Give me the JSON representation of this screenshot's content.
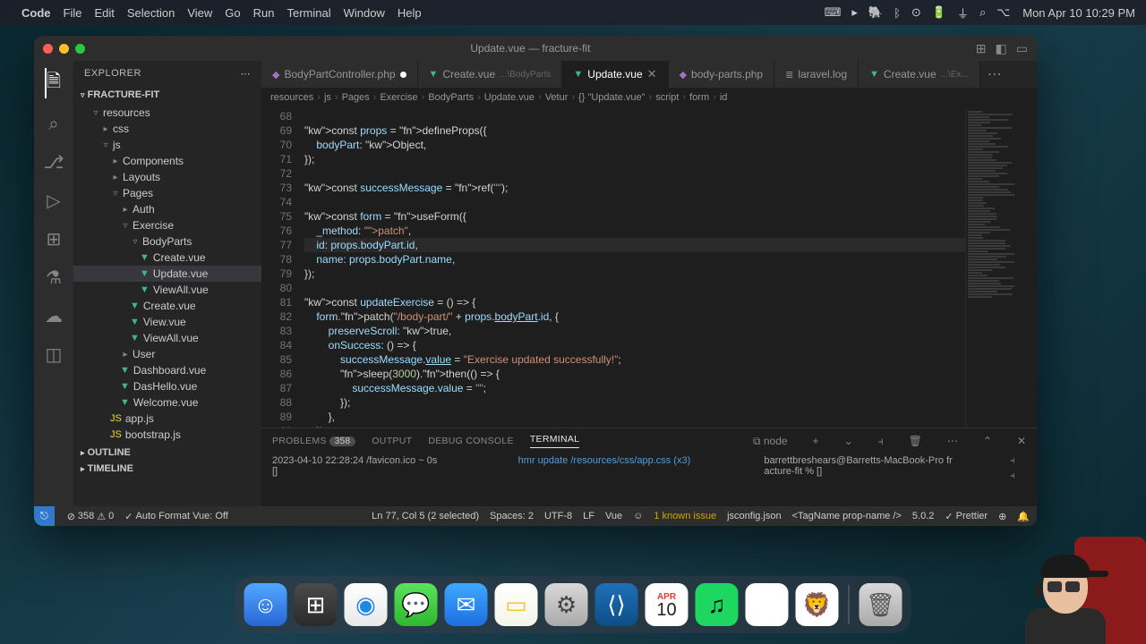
{
  "menubar": {
    "app": "Code",
    "items": [
      "File",
      "Edit",
      "Selection",
      "View",
      "Go",
      "Run",
      "Terminal",
      "Window",
      "Help"
    ],
    "clock": "Mon Apr 10  10:29 PM"
  },
  "titlebar": {
    "title": "Update.vue — fracture-fit"
  },
  "activity": {
    "icons": [
      "files",
      "search",
      "scm",
      "debug",
      "extensions",
      "remote",
      "test",
      "settings",
      "user"
    ]
  },
  "sidebar": {
    "title": "EXPLORER",
    "project": "FRACTURE-FIT",
    "tree": [
      {
        "l": "resources",
        "d": 1,
        "o": true
      },
      {
        "l": "css",
        "d": 2
      },
      {
        "l": "js",
        "d": 2,
        "o": true
      },
      {
        "l": "Components",
        "d": 3
      },
      {
        "l": "Layouts",
        "d": 3
      },
      {
        "l": "Pages",
        "d": 3,
        "o": true
      },
      {
        "l": "Auth",
        "d": 4
      },
      {
        "l": "Exercise",
        "d": 4,
        "o": true
      },
      {
        "l": "BodyParts",
        "d": 5,
        "o": true
      },
      {
        "l": "Create.vue",
        "d": 6,
        "t": "vue"
      },
      {
        "l": "Update.vue",
        "d": 6,
        "t": "vue",
        "sel": true
      },
      {
        "l": "ViewAll.vue",
        "d": 6,
        "t": "vue"
      },
      {
        "l": "Create.vue",
        "d": 5,
        "t": "vue"
      },
      {
        "l": "View.vue",
        "d": 5,
        "t": "vue"
      },
      {
        "l": "ViewAll.vue",
        "d": 5,
        "t": "vue"
      },
      {
        "l": "User",
        "d": 4
      },
      {
        "l": "Dashboard.vue",
        "d": 4,
        "t": "vue"
      },
      {
        "l": "DasHello.vue",
        "d": 4,
        "t": "vue"
      },
      {
        "l": "Welcome.vue",
        "d": 4,
        "t": "vue"
      },
      {
        "l": "app.js",
        "d": 3,
        "t": "js"
      },
      {
        "l": "bootstrap.js",
        "d": 3,
        "t": "js"
      }
    ],
    "outline": "OUTLINE",
    "timeline": "TIMELINE"
  },
  "tabs": [
    {
      "l": "BodyPartController.php",
      "icon": "php",
      "mod": true
    },
    {
      "l": "Create.vue",
      "hint": "...\\BodyParts",
      "icon": "vue"
    },
    {
      "l": "Update.vue",
      "icon": "vue",
      "active": true,
      "close": true
    },
    {
      "l": "body-parts.php",
      "icon": "php"
    },
    {
      "l": "laravel.log",
      "icon": "log"
    },
    {
      "l": "Create.vue",
      "hint": "...\\Ex...",
      "icon": "vue"
    }
  ],
  "breadcrumb": [
    "resources",
    "js",
    "Pages",
    "Exercise",
    "BodyParts",
    "Update.vue",
    "Vetur",
    "{} \"Update.vue\"",
    "script",
    "form",
    "id"
  ],
  "code": {
    "start": 68,
    "hl": 77,
    "lines": [
      "",
      "const props = defineProps({",
      "    bodyPart: Object,",
      "});",
      "",
      "const successMessage = ref(\"\");",
      "",
      "const form = useForm({",
      "    _method: \"patch\",",
      "    id: props.bodyPart.id,",
      "    name: props.bodyPart.name,",
      "});",
      "",
      "const updateExercise = () => {",
      "    form.patch(\"/body-part/\" + props.bodyPart.id, {",
      "        preserveScroll: true,",
      "        onSuccess: () => {",
      "            successMessage.value = \"Exercise updated successfully!\";",
      "            sleep(3000).then(() => {",
      "                successMessage.value = \"\";",
      "            });",
      "        },",
      "    });",
      "};"
    ]
  },
  "panel": {
    "tabs": {
      "problems": "PROBLEMS",
      "problems_count": "358",
      "output": "OUTPUT",
      "debug": "DEBUG CONSOLE",
      "terminal": "TERMINAL"
    },
    "term_kind": "node",
    "col1": "2023-04-10 22:28:24 /favicon.ico ~ 0s",
    "col2": "hmr update /resources/css/app.css (x3)",
    "col3": "barrettbreshears@Barretts-MacBook-Pro fr\nacture-fit % []"
  },
  "status": {
    "errors": "358",
    "warnings": "0",
    "autoformat": "Auto Format Vue: Off",
    "cursor": "Ln 77, Col 5 (2 selected)",
    "spaces": "Spaces: 2",
    "enc": "UTF-8",
    "eol": "LF",
    "lang": "Vue",
    "issue": "1 known issue",
    "jsconfig": "jsconfig.json",
    "tagname": "<TagName prop-name />",
    "ver": "5.0.2",
    "prettier": "Prettier"
  },
  "dock": {
    "calendar_month": "APR",
    "calendar_day": "10"
  }
}
